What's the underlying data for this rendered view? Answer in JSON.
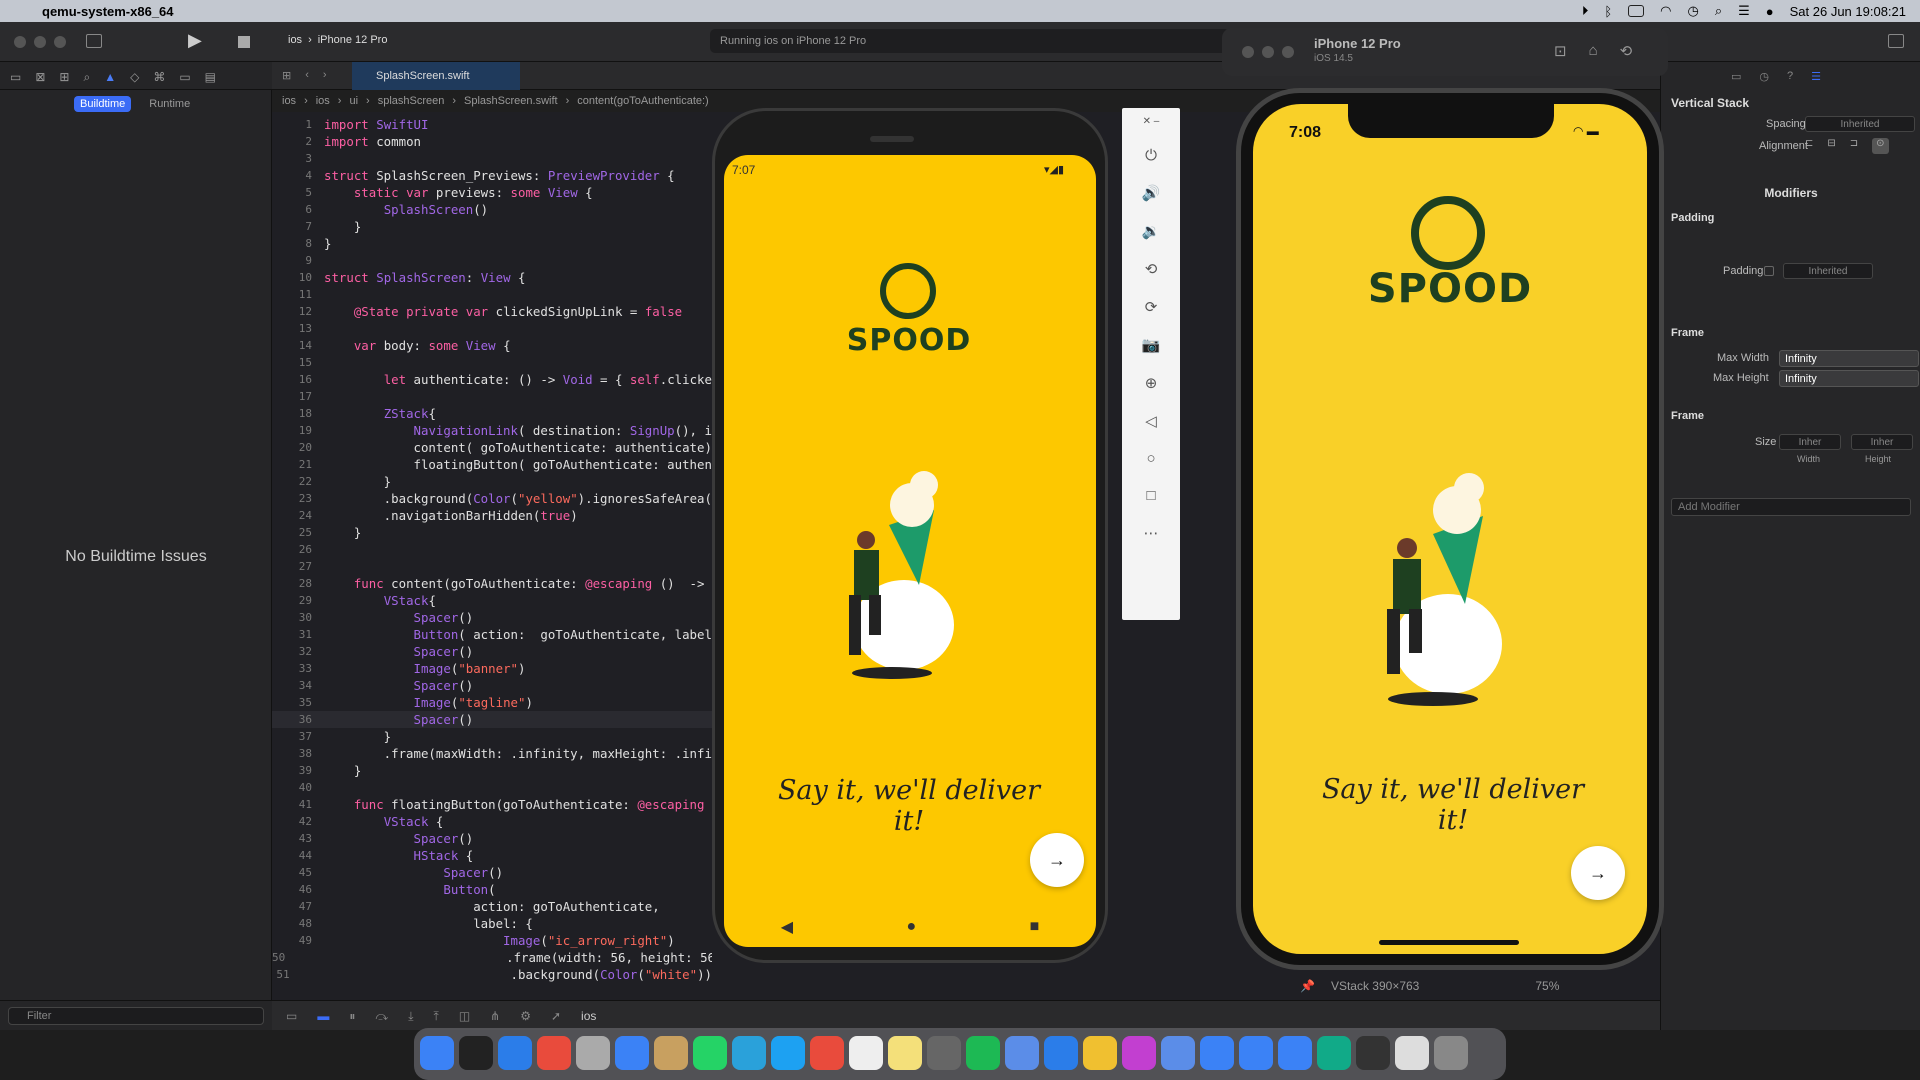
{
  "menubar": {
    "app_name": "qemu-system-x86_64",
    "datetime": "Sat 26 Jun  19:08:21"
  },
  "toolbar": {
    "scheme": "ios",
    "device": "iPhone 12 Pro",
    "status": "Running ios on iPhone 12 Pro"
  },
  "editor_tab": {
    "file": "SplashScreen.swift"
  },
  "jump_bar": [
    "ios",
    "ios",
    "ui",
    "splashScreen",
    "SplashScreen.swift",
    "content(goToAuthenticate:)"
  ],
  "navigator": {
    "tabs": [
      "Buildtime",
      "Runtime"
    ],
    "empty_message": "No Buildtime Issues",
    "filter_placeholder": "Filter"
  },
  "code_lines": [
    "import SwiftUI",
    "import common",
    "",
    "struct SplashScreen_Previews: PreviewProvider {",
    "    static var previews: some View {",
    "        SplashScreen()",
    "    }",
    "}",
    "",
    "struct SplashScreen: View {",
    "",
    "    @State private var clickedSignUpLink = false",
    "",
    "    var body: some View {",
    "",
    "        let authenticate: () -> Void = { self.clicke",
    "",
    "        ZStack{",
    "            NavigationLink( destination: SignUp(), i",
    "            content( goToAuthenticate: authenticate)",
    "            floatingButton( goToAuthenticate: authen",
    "        }",
    "        .background(Color(\"yellow\").ignoresSafeArea(",
    "        .navigationBarHidden(true)",
    "    }",
    "",
    "",
    "    func content(goToAuthenticate: @escaping ()  ->",
    "        VStack{",
    "            Spacer()",
    "            Button( action:  goToAuthenticate, label",
    "            Spacer()",
    "            Image(\"banner\")",
    "            Spacer()",
    "            Image(\"tagline\")",
    "            Spacer()",
    "        }",
    "        .frame(maxWidth: .infinity, maxHeight: .infi",
    "    }",
    "",
    "    func floatingButton(goToAuthenticate: @escaping",
    "        VStack {",
    "            Spacer()",
    "            HStack {",
    "                Spacer()",
    "                Button(",
    "                    action: goToAuthenticate,",
    "                    label: {",
    "                        Image(\"ic_arrow_right\")",
    "                            .frame(width: 56, height: 56",
    "                            .background(Color(\"white\"))"
  ],
  "android": {
    "time": "7:07",
    "brand": "SPOOD",
    "tagline": "Say it, we'll deliver it!",
    "fab_icon": "arrow-right"
  },
  "ios_sim": {
    "window_title": "iPhone 12 Pro",
    "window_sub": "iOS 14.5",
    "time": "7:08",
    "brand": "SPOOD",
    "tagline": "Say it, we'll deliver it!"
  },
  "canvas_footer": {
    "info": "VStack 390×763",
    "zoom": "75%"
  },
  "debug": {
    "target": "ios"
  },
  "inspector": {
    "title": "Vertical Stack",
    "spacing_label": "Spacing",
    "spacing_value": "Inherited",
    "alignment_label": "Alignment",
    "modifiers_title": "Modifiers",
    "padding_section": "Padding",
    "padding_label": "Padding",
    "padding_value": "Inherited",
    "frame_section": "Frame",
    "max_width_label": "Max Width",
    "max_width_value": "Infinity",
    "max_height_label": "Max Height",
    "max_height_value": "Infinity",
    "frame2_section": "Frame",
    "size_label": "Size",
    "width_value": "Inher",
    "height_value": "Inher",
    "width_label": "Width",
    "height_label": "Height",
    "add_modifier": "Add Modifier"
  },
  "colors": {
    "brand_yellow": "#fdc800",
    "brand_green": "#1e4020",
    "accent": "#3b6cf6"
  }
}
